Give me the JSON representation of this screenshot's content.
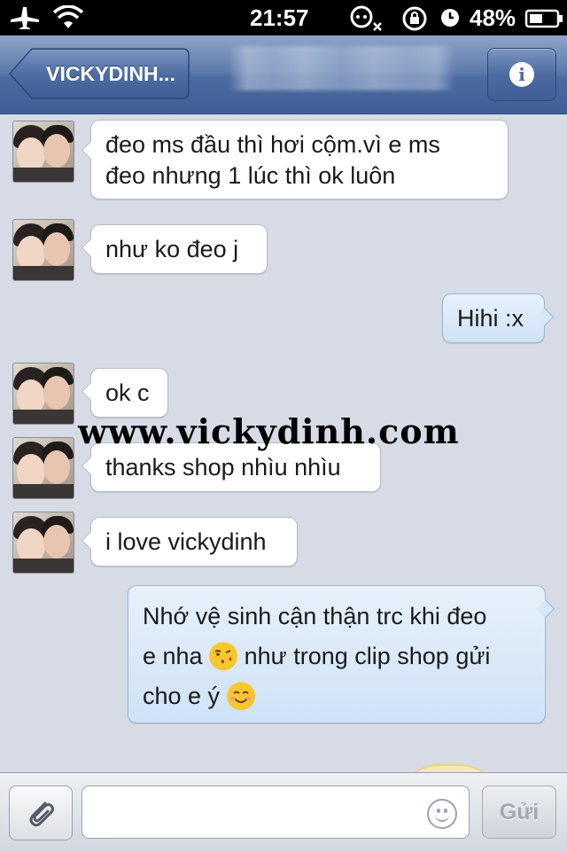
{
  "status_bar": {
    "time": "21:57",
    "battery": "48%"
  },
  "nav": {
    "back_label": "VICKYDINH...",
    "info_label": "i"
  },
  "messages": [
    {
      "dir": "in",
      "lines": [
        "đeo ms đầu thì hơi cộm.vì e ms",
        "đeo nhưng 1 lúc thì ok luôn"
      ]
    },
    {
      "dir": "in",
      "lines": [
        "như ko đeo j"
      ]
    },
    {
      "dir": "out",
      "lines": [
        "Hihi :x"
      ]
    },
    {
      "dir": "in",
      "lines": [
        "ok c"
      ]
    },
    {
      "dir": "in",
      "lines": [
        "thanks shop nhìu nhìu"
      ]
    },
    {
      "dir": "in",
      "lines": [
        "i love vickydinh"
      ]
    },
    {
      "dir": "out",
      "line1": "Nhớ vệ sinh cận thận trc khi đeo",
      "line2_a": "e nha",
      "line2_b": "như trong clip shop gửi",
      "line3": "cho e ý"
    }
  ],
  "icons": {
    "kiss_emoji": "kissing-face-emoji",
    "smile_emoji": "smiling-face-emoji"
  },
  "watermark": "www.vickydinh.com",
  "compose": {
    "input_value": "",
    "send_label": "Gửi"
  },
  "colors": {
    "nav_blue": "#4a6aa0",
    "outgoing_bubble": "#d8e8f8",
    "incoming_bubble": "#ffffff"
  }
}
